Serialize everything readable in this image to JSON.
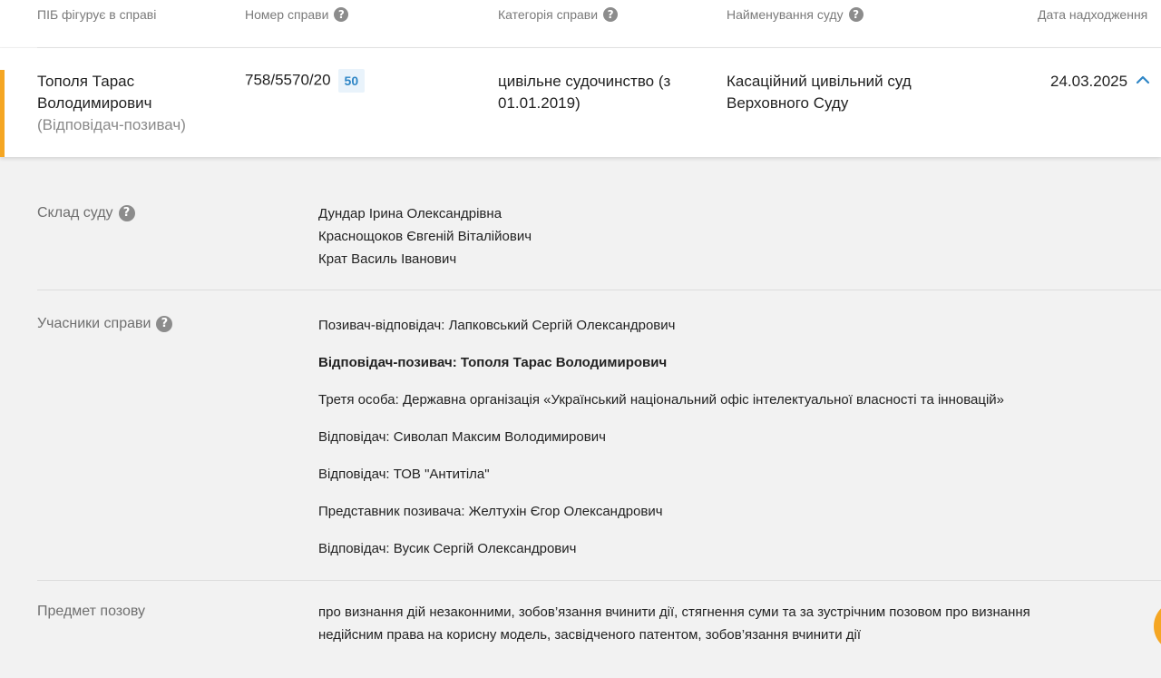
{
  "header": {
    "col_person": "ПІБ фігурує в справі",
    "col_case_number": "Номер справи",
    "col_category": "Категорія справи",
    "col_court": "Найменування суду",
    "col_date": "Дата надходження"
  },
  "case": {
    "person_name_line1": "Тополя Тарас",
    "person_name_line2": "Володимирович",
    "person_role": "(Відповідач-позивач)",
    "case_number": "758/5570/20",
    "badge_count": "50",
    "category_line1": "цивільне судочинство (з",
    "category_line2": "01.01.2019)",
    "court_line1": "Касаційний цивільний суд",
    "court_line2": "Верховного Суду",
    "date": "24.03.2025"
  },
  "details": {
    "composition_label": "Склад суду",
    "judges": [
      "Дундар Ірина Олександрівна",
      "Краснощоков Євгеній Віталійович",
      "Крат Василь Іванович"
    ],
    "participants_label": "Учасники справи",
    "participants": [
      "Позивач-відповідач: Лапковський Сергій Олександрович",
      "Відповідач-позивач: Тополя Тарас Володимирович",
      "Третя особа: Державна організація «Український національний офіс інтелектуальної власності та інновацій»",
      "Відповідач: Сиволап Максим Володимирович",
      "Відповідач: ТОВ \"Антитіла\"",
      "Представник позивача: Желтухін Єгор Олександрович",
      "Відповідач: Вусик Сергій Олександрович"
    ],
    "subject_label": "Предмет позову",
    "subject_line1": "про визнання дій незаконними, зобов’язання вчинити дії, стягнення суми та за зустрічним позовом про визнання",
    "subject_line2": "недійсним права на корисну модель, засвідченого патентом, зобов’язання вчинити дії"
  },
  "icons": {
    "help": "help-icon",
    "collapse": "chevron-up-icon"
  },
  "colors": {
    "accent": "#f5a623",
    "badge_text": "#2f86c6",
    "badge_bg": "#e9f3fb"
  }
}
